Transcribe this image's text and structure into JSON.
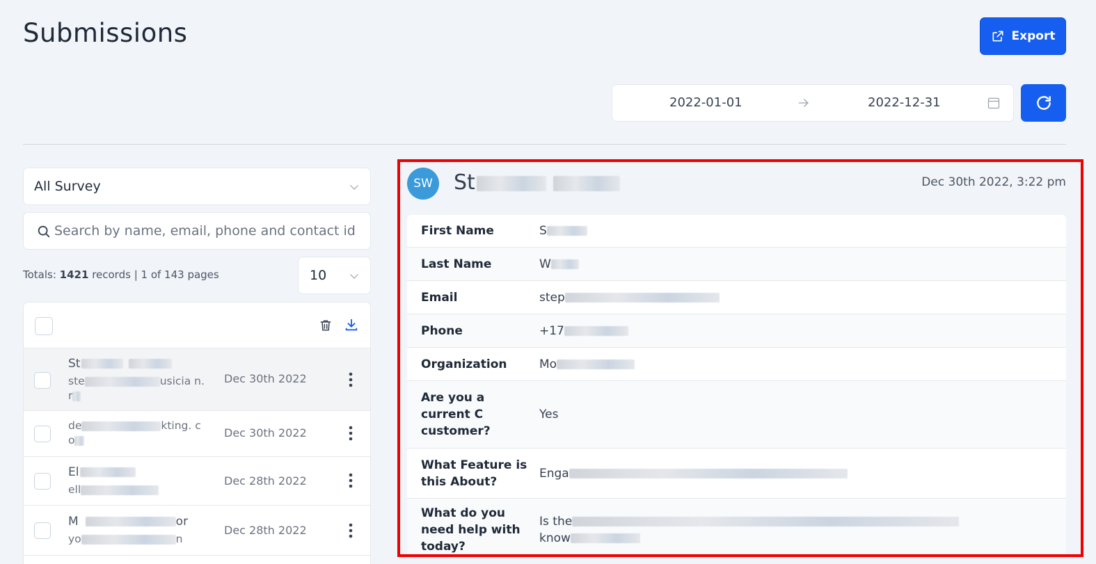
{
  "page": {
    "title": "Submissions"
  },
  "toolbar": {
    "export_label": "Export"
  },
  "date_range": {
    "start": "2022-01-01",
    "end": "2022-12-31"
  },
  "filters": {
    "survey_select": "All Survey",
    "search_placeholder": "Search by name, email, phone and contact id",
    "page_size": "10"
  },
  "totals": {
    "prefix": "Totals: ",
    "records": "1421",
    "suffix": " records | 1 of 143 pages"
  },
  "submissions": [
    {
      "name": "St",
      "email": "ste",
      "email_tail": "usicia n.r",
      "date": "Dec 30th 2022"
    },
    {
      "name": "",
      "email": "de",
      "email_tail": "kting. co",
      "date": "Dec 30th 2022"
    },
    {
      "name": "El",
      "email": "ell",
      "email_tail": "",
      "date": "Dec 28th 2022"
    },
    {
      "name": "M",
      "name_tail": "or",
      "email": "yo",
      "email_tail": "n",
      "date": "Dec 28th 2022"
    }
  ],
  "detail": {
    "avatar_initials": "SW",
    "name": "St",
    "submitted_at": "Dec 30th 2022, 3:22 pm",
    "fields": [
      {
        "label": "First Name",
        "value": "S"
      },
      {
        "label": "Last Name",
        "value": "W"
      },
      {
        "label": "Email",
        "value": "step"
      },
      {
        "label": "Phone",
        "value": "+17"
      },
      {
        "label": "Organization",
        "value": "Mo"
      },
      {
        "label": "Are you a current C customer?",
        "value": "Yes"
      },
      {
        "label": "What Feature is this About?",
        "value": "Enga"
      },
      {
        "label": "What do you need help with today?",
        "value": "Is the",
        "value_line2": "know"
      }
    ]
  },
  "colors": {
    "primary": "#155eef",
    "avatar": "#3b9ad9",
    "highlight_border": "#ef0000"
  }
}
